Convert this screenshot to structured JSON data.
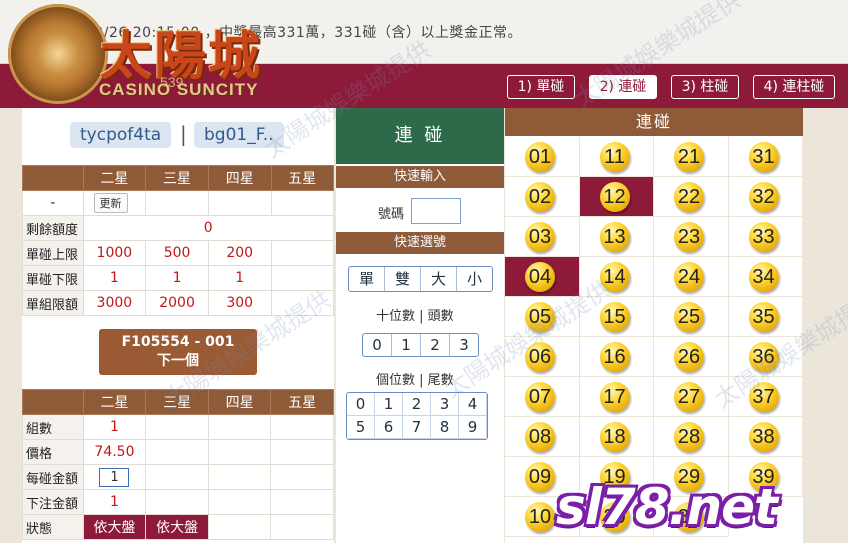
{
  "notice": {
    "text": "最後更新 02/26 20:15:00 ，中獎最高331萬，331碰（含）以上獎金正常。"
  },
  "logo": {
    "cn": "太陽城",
    "en": "CASINO SUNCITY",
    "num": "539"
  },
  "modes": [
    "1) 單碰",
    "2) 連碰",
    "3) 柱碰",
    "4) 連柱碰"
  ],
  "users": [
    "tycpof4ta",
    "bg01_F.."
  ],
  "user_sep": "|",
  "limits": {
    "headers": [
      "",
      "二星",
      "三星",
      "四星",
      "五星"
    ],
    "dash": "-",
    "update_label": "更新",
    "rows": [
      {
        "label": "剩餘額度",
        "values": [
          "0"
        ]
      },
      {
        "label": "單碰上限",
        "values": [
          "1000",
          "500",
          "200",
          ""
        ]
      },
      {
        "label": "單碰下限",
        "values": [
          "1",
          "1",
          "1",
          ""
        ]
      },
      {
        "label": "單組限額",
        "values": [
          "3000",
          "2000",
          "300",
          ""
        ]
      }
    ]
  },
  "order": {
    "id": "F105554 - 001",
    "next": "下一個"
  },
  "bet": {
    "headers": [
      "",
      "二星",
      "三星",
      "四星",
      "五星"
    ],
    "rows": [
      {
        "label": "組數",
        "values": [
          "1",
          "",
          "",
          ""
        ]
      },
      {
        "label": "價格",
        "values": [
          "74.50",
          "",
          "",
          ""
        ]
      },
      {
        "label": "每碰金額",
        "values": [
          "1",
          "",
          "",
          ""
        ]
      },
      {
        "label": "下注金額",
        "values": [
          "1",
          "",
          "",
          ""
        ]
      },
      {
        "label": "狀態",
        "values": [
          "依大盤",
          "依大盤",
          "",
          ""
        ]
      }
    ]
  },
  "mid": {
    "title": "連 碰",
    "quick_input": "快速輸入",
    "number_label": "號碼",
    "quick_select": "快速選號",
    "parity": [
      "單",
      "雙",
      "大",
      "小"
    ],
    "tens_label": "十位數 | 頭數",
    "tens": [
      "0",
      "1",
      "2",
      "3"
    ],
    "units_label": "個位數 | 尾數",
    "units": [
      "0",
      "1",
      "2",
      "3",
      "4",
      "5",
      "6",
      "7",
      "8",
      "9"
    ]
  },
  "board": {
    "title": "連碰",
    "balls": [
      "01",
      "11",
      "21",
      "31",
      "02",
      "12",
      "22",
      "32",
      "03",
      "13",
      "23",
      "33",
      "04",
      "14",
      "24",
      "34",
      "05",
      "15",
      "25",
      "35",
      "06",
      "16",
      "26",
      "36",
      "07",
      "17",
      "27",
      "37",
      "08",
      "18",
      "28",
      "38",
      "09",
      "19",
      "29",
      "39",
      "10",
      "20",
      "30"
    ],
    "selected": [
      "12",
      "04"
    ]
  },
  "watermark": {
    "text": "太陽城娛樂城提供",
    "site": "sl78.net"
  },
  "colors": {
    "maroon": "#8e1a3a",
    "brown": "#8e5a38",
    "green": "#2e6a4a",
    "ball": "#ffd83a"
  }
}
